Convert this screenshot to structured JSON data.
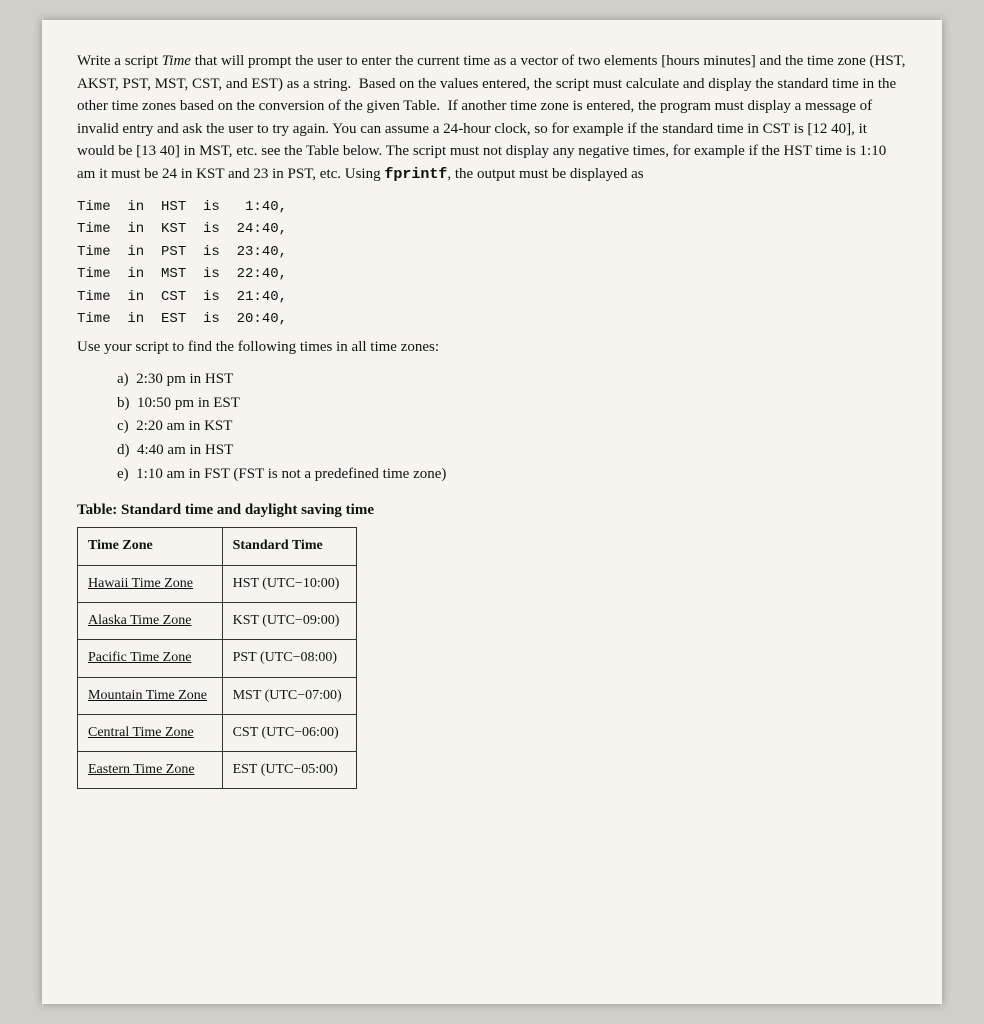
{
  "intro_paragraph": "Write a script Time that will prompt the user to enter the current time as a vector of two elements [hours minutes] and the time zone (HST, AKST, PST, MST, CST, and EST) as a string. Based on the values entered, the script must calculate and display the standard time in the other time zones based on the conversion of the given Table. If another time zone is entered, the program must display a message of invalid entry and ask the user to try again. You can assume a 24-hour clock, so for example if the standard time in CST is [12 40], it would be [13 40] in MST, etc. see the Table below. The script must not display any negative times, for example if the HST time is 1:10 am it must be 24 in KST and 23 in PST, etc. Using",
  "fprintf_inline": "fprintf",
  "after_fprintf": ", the output must be displayed as",
  "code_lines": [
    "Time  in  HST  is   1:40,",
    "Time  in  KST  is  24:40,",
    "Time  in  PST  is  23:40,",
    "Time  in  MST  is  22:40,",
    "Time  in  CST  is  21:40,",
    "Time  in  EST  is  20:40,"
  ],
  "after_code": "Use your script to find the following times in all time zones:",
  "list_items": [
    {
      "label": "a)",
      "text": "2:30 pm in HST"
    },
    {
      "label": "b)",
      "text": "10:50 pm in EST"
    },
    {
      "label": "c)",
      "text": "2:20 am in KST"
    },
    {
      "label": "d)",
      "text": "4:40 am in HST"
    },
    {
      "label": "e)",
      "text": "1:10 am in FST (FST is not a predefined time zone)"
    }
  ],
  "table_caption": "Table: Standard time and daylight saving time",
  "table_headers": [
    "Time Zone",
    "Standard Time"
  ],
  "table_rows": [
    {
      "zone": "Hawaii Time Zone",
      "standard": "HST (UTC−10:00)"
    },
    {
      "zone": "Alaska Time Zone",
      "standard": "KST (UTC−09:00)"
    },
    {
      "zone": "Pacific Time Zone",
      "standard": "PST (UTC−08:00)"
    },
    {
      "zone": "Mountain Time Zone",
      "standard": "MST (UTC−07:00)"
    },
    {
      "zone": "Central Time Zone",
      "standard": "CST (UTC−06:00)"
    },
    {
      "zone": "Eastern Time Zone",
      "standard": "EST (UTC−05:00)"
    }
  ]
}
